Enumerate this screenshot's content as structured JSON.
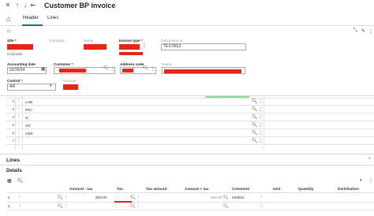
{
  "toolbar": {
    "close": "✕",
    "prev": "↑",
    "next": "↓",
    "first": "⇤",
    "title": "Customer BP invoice"
  },
  "tabs": {
    "header": "Header",
    "lines": "Lines"
  },
  "header_form": {
    "site": {
      "label": "Site",
      "sub": "Corporate"
    },
    "company": {
      "label": "Company"
    },
    "name": {
      "label": "Name"
    },
    "invoice_type": {
      "label": "Invoice type"
    },
    "document_no": {
      "label": "Document no.",
      "value": "TESTBS2"
    },
    "accounting_date": {
      "label": "Accounting date",
      "value": "02/26/24"
    },
    "customer": {
      "label": "Customer",
      "prefix": "→"
    },
    "address_code": {
      "label": "Address code"
    },
    "name2": {
      "label": "Name"
    },
    "control": {
      "label": "Control",
      "value": "AR"
    },
    "account": {
      "label": "Account"
    }
  },
  "control_rows": [
    {
      "num": "2",
      "value": "LOB"
    },
    {
      "num": "3",
      "value": "PRJ"
    },
    {
      "num": "4",
      "value": "IC"
    },
    {
      "num": "5",
      "value": "SIT"
    },
    {
      "num": "6",
      "value": "CER"
    },
    {
      "num": "7",
      "value": ""
    }
  ],
  "lines_section": {
    "title": "Lines",
    "details_title": "Details",
    "columns": [
      "Amount - tax",
      "Tax",
      "Tax amount",
      "Amount + tax",
      "Comment",
      "Unit",
      "Quantity",
      "Distribution"
    ],
    "rows": [
      {
        "num": "1",
        "amount_tax": "500.00",
        "amount_plus_tax": "500.00",
        "comment": "testbs2"
      },
      {
        "num": "2"
      }
    ]
  },
  "colors": {
    "accent": "#1b6d92",
    "redaction": "#e4251b",
    "required": "#d0021b"
  }
}
